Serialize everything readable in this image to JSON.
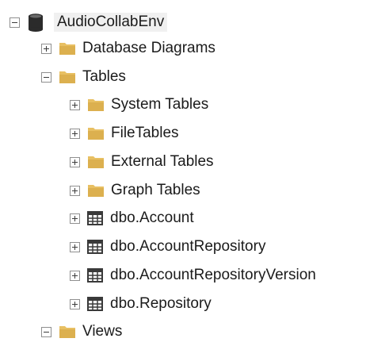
{
  "object_explorer": {
    "database": {
      "label": "AudioCollabEnv",
      "expanded": true,
      "icon": "database-icon"
    },
    "database_diagrams": {
      "label": "Database Diagrams",
      "expanded": false,
      "icon": "folder-icon"
    },
    "tables": {
      "label": "Tables",
      "expanded": true,
      "icon": "folder-icon",
      "folders": [
        {
          "label": "System Tables",
          "expanded": false,
          "icon": "folder-icon"
        },
        {
          "label": "FileTables",
          "expanded": false,
          "icon": "folder-icon"
        },
        {
          "label": "External Tables",
          "expanded": false,
          "icon": "folder-icon"
        },
        {
          "label": "Graph Tables",
          "expanded": false,
          "icon": "folder-icon"
        }
      ],
      "items": [
        {
          "label": "dbo.Account",
          "expanded": false,
          "icon": "table-icon"
        },
        {
          "label": "dbo.AccountRepository",
          "expanded": false,
          "icon": "table-icon"
        },
        {
          "label": "dbo.AccountRepositoryVersion",
          "expanded": false,
          "icon": "table-icon"
        },
        {
          "label": "dbo.Repository",
          "expanded": false,
          "icon": "table-icon"
        }
      ]
    },
    "views": {
      "label": "Views",
      "expanded": true,
      "icon": "folder-icon"
    }
  },
  "colors": {
    "folder": "#e8c063",
    "database": "#2b2b2b",
    "table_grid": "#3a3a3a"
  }
}
